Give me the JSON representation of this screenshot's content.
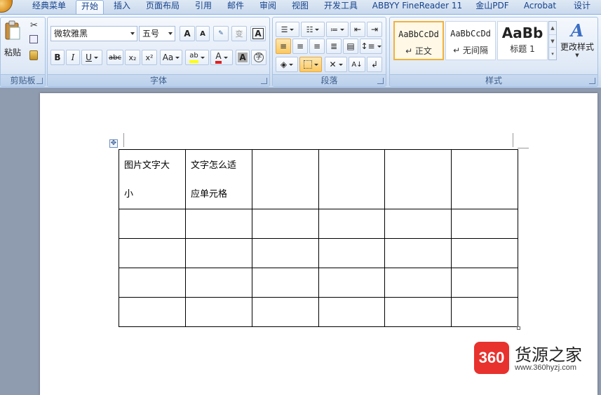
{
  "tabs": [
    "经典菜单",
    "开始",
    "插入",
    "页面布局",
    "引用",
    "邮件",
    "审阅",
    "视图",
    "开发工具",
    "ABBYY FineReader 11",
    "金山PDF",
    "Acrobat",
    "设计"
  ],
  "active_tab": "开始",
  "clipboard": {
    "paste_label": "粘贴",
    "group_label": "剪贴板"
  },
  "font": {
    "font_name": "微软雅黑",
    "font_size": "五号",
    "grow_label": "A",
    "shrink_label": "A",
    "bold": "B",
    "italic": "I",
    "underline": "U",
    "strike": "abc",
    "subscript": "x₂",
    "superscript": "x²",
    "case_label": "Aa",
    "highlight_label": "ab",
    "font_color_label": "A",
    "group_label": "字体"
  },
  "paragraph": {
    "group_label": "段落"
  },
  "styles": {
    "tiles": [
      {
        "sample": "AaBbCcDd",
        "name": "↵ 正文"
      },
      {
        "sample": "AaBbCcDd",
        "name": "↵ 无间隔"
      },
      {
        "sample": "AaBb",
        "name": "标题 1"
      }
    ],
    "change_styles": "更改样式",
    "group_label": "样式"
  },
  "table": {
    "rows": [
      [
        "图片文字大\n小",
        "文字怎么适\n应单元格",
        "",
        "",
        "",
        ""
      ],
      [
        "",
        "",
        "",
        "",
        "",
        ""
      ],
      [
        "",
        "",
        "",
        "",
        "",
        ""
      ],
      [
        "",
        "",
        "",
        "",
        "",
        ""
      ],
      [
        "",
        "",
        "",
        "",
        "",
        ""
      ]
    ]
  },
  "watermark": {
    "badge": "360",
    "title": "货源之家",
    "url": "www.360hyzj.com"
  },
  "colors": {
    "highlight": "#ffff00",
    "font_color": "#e02020",
    "accent": "#f0b23c"
  }
}
